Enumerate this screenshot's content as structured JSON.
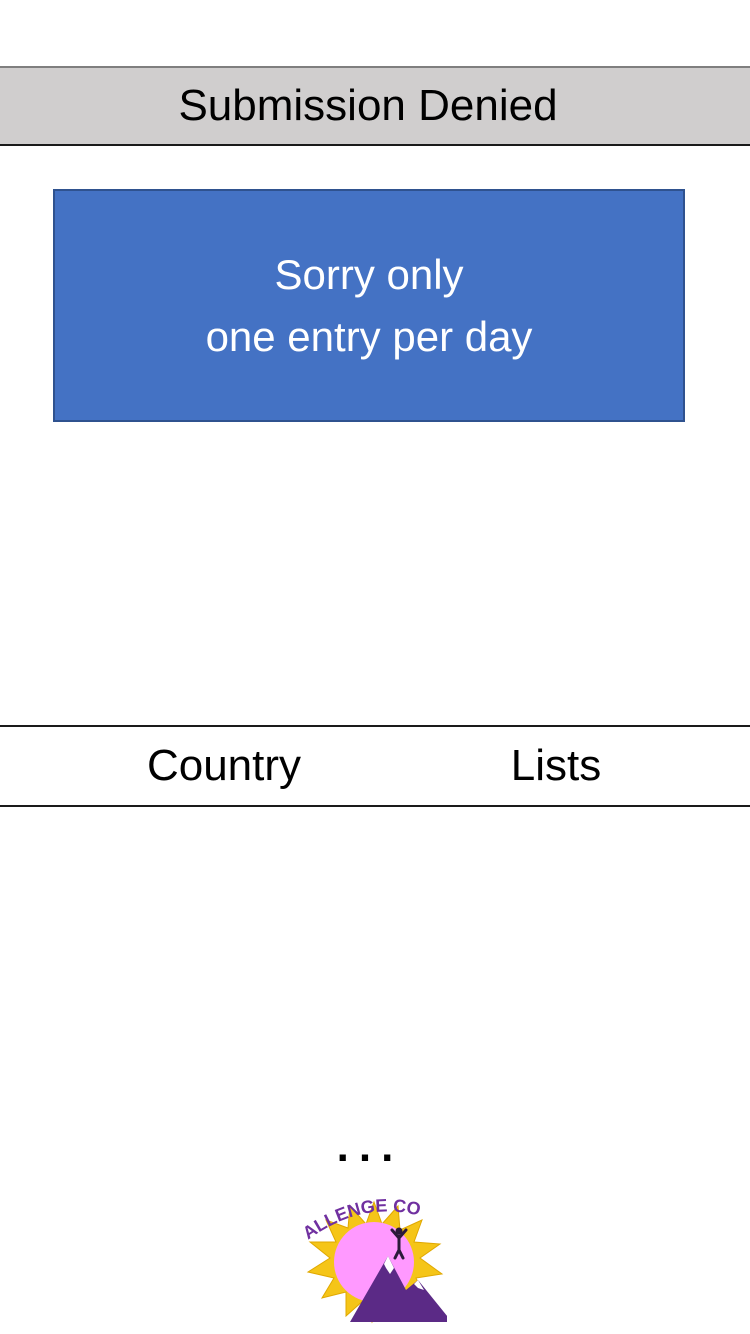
{
  "header": {
    "title": "Submission Denied"
  },
  "message": {
    "line1": "Sorry only",
    "line2": "one entry per day"
  },
  "nav": {
    "items": [
      {
        "label": "Country"
      },
      {
        "label": "Lists"
      }
    ]
  },
  "more": {
    "label": "..."
  },
  "logo": {
    "text": "ALLENGE CO"
  },
  "colors": {
    "header_bg": "#d0cece",
    "message_bg": "#4472c4",
    "message_text": "#ffffff",
    "logo_sun": "#f5c518",
    "logo_fill": "#ff99ff",
    "logo_text": "#7030a0"
  }
}
